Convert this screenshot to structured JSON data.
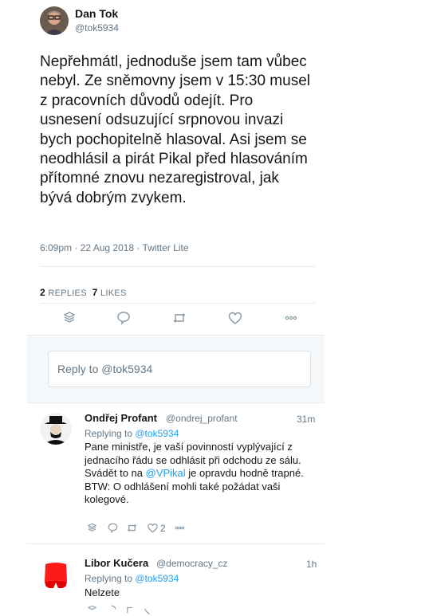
{
  "tweet": {
    "author_name": "Dan Tok",
    "author_handle": "@tok5934",
    "text": "Nepřehmátl, jednoduše jsem tam vůbec nebyl. Ze sněmovny jsem v 15:30 musel z pracovních důvodů odejít. Pro usnesení odsuzující srpnovou invazi bych pochopitelně hlasoval. Asi jsem se neodhlásil a pirát Pikal před hlasováním přítomné znovu nezaregistroval, jak bývá dobrým zvykem.",
    "timestamp": "6:09pm · 22 Aug 2018 · Twitter Lite",
    "replies_count": "2",
    "replies_label": "REPLIES",
    "likes_count": "7",
    "likes_label": "LIKES"
  },
  "reply_box": {
    "placeholder": "Reply to @tok5934"
  },
  "replies": [
    {
      "name": "Ondřej Profant",
      "handle": "@ondrej_profant",
      "time": "31m",
      "replying_prefix": "Replying to",
      "replying_to": "@tok5934",
      "text_1": "Pane ministře, je vaší povinností vyplývající z jednacího řádu se odhlásit při odchodu ze sálu. Svádět to na ",
      "mention": "@VPikal",
      "text_2": " je opravdu hodně trapné. BTW: O odhlášení mohli také požádat vaši kolegové.",
      "like_count": "2"
    },
    {
      "name": "Libor Kučera",
      "handle": "@democracy_cz",
      "time": "1h",
      "replying_prefix": "Replying to",
      "replying_to": "@tok5934",
      "text": "Nelzete"
    }
  ],
  "icons": {
    "colors": {
      "icon_gray": "#8899a6",
      "link_blue": "#1da1f2",
      "text": "#14171a",
      "secondary": "#657786",
      "border": "#e6ecf0"
    }
  }
}
